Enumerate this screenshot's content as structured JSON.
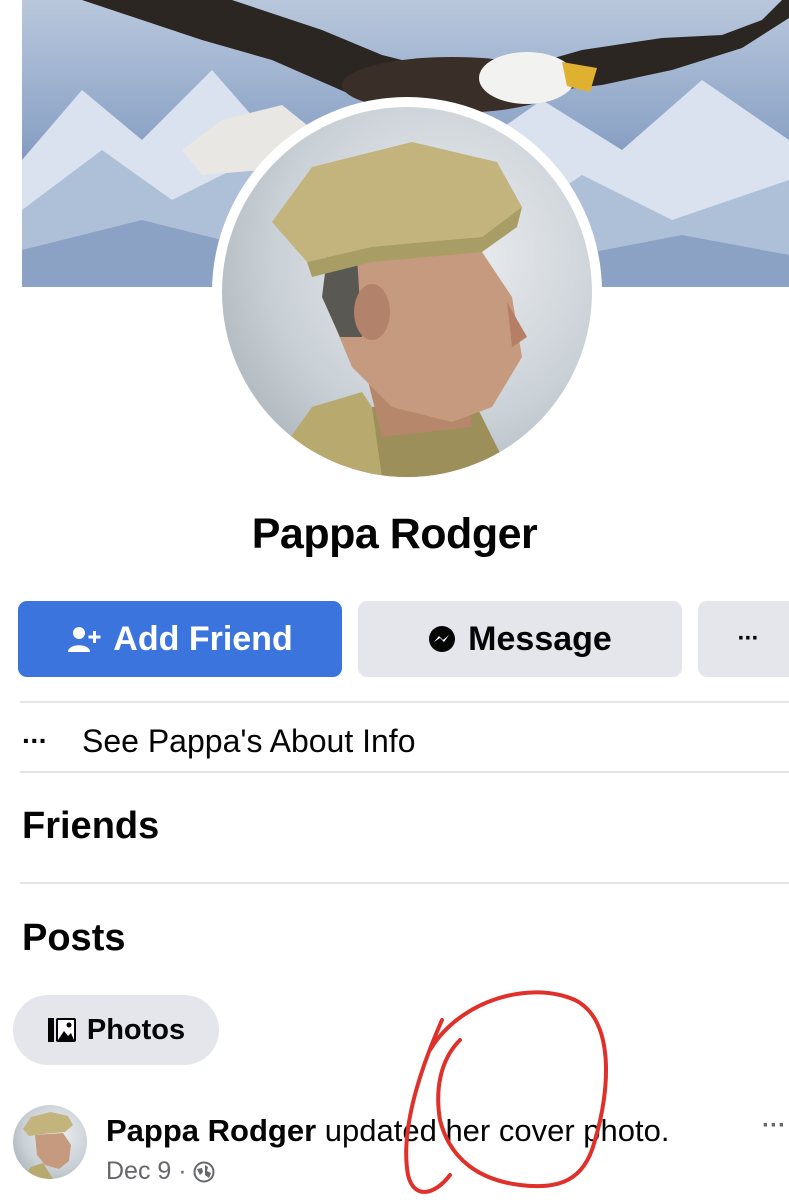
{
  "profile": {
    "name": "Pappa Rodger"
  },
  "actions": {
    "add_friend_label": "Add Friend",
    "message_label": "Message",
    "more_label": "···"
  },
  "about": {
    "dots": "···",
    "label": "See Pappa's About Info"
  },
  "sections": {
    "friends": "Friends",
    "posts": "Posts"
  },
  "photos_chip": {
    "label": "Photos"
  },
  "post": {
    "author": "Pappa Rodger",
    "action_text": " updated her cover photo.",
    "date": "Dec 9 ·",
    "more": "···"
  },
  "colors": {
    "primary_button": "#3b74dd",
    "secondary_button": "#e4e6eb",
    "annotation_circle": "#e0302a"
  },
  "icons": {
    "add_friend": "person-add-icon",
    "message": "messenger-icon",
    "photos": "photo-icon",
    "privacy": "globe-icon"
  }
}
